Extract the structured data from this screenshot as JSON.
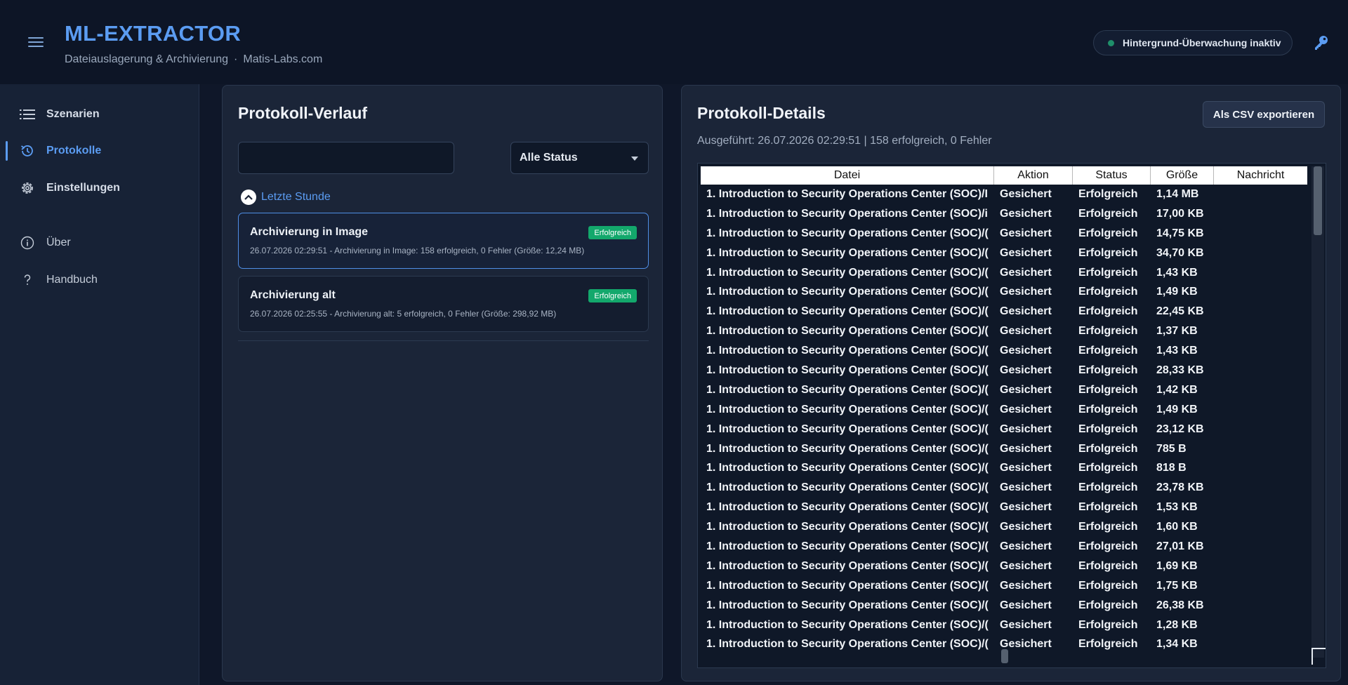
{
  "header": {
    "title": "ML-EXTRACTOR",
    "subtitle": "Dateiauslagerung & Archivierung",
    "subtitle_sep": "·",
    "site": "Matis-Labs.com",
    "monitor_status": "Hintergrund-Überwachung inaktiv",
    "monitor_dot_color": "#1f8f6a"
  },
  "sidebar": {
    "items": [
      {
        "label": "Szenarien",
        "icon": "list-icon"
      },
      {
        "label": "Protokolle",
        "icon": "history-icon"
      },
      {
        "label": "Einstellungen",
        "icon": "gear-icon"
      },
      {
        "label": "Über",
        "icon": "info-icon"
      },
      {
        "label": "Handbuch",
        "icon": "help-icon"
      }
    ],
    "active": "Protokolle"
  },
  "history": {
    "title": "Protokoll-Verlauf",
    "search_value": "",
    "status_filter": "Alle Status",
    "group_label": "Letzte Stunde",
    "entries": [
      {
        "name": "Archivierung in Image",
        "badge": "Erfolgreich",
        "meta": "26.07.2026 02:29:51 - Archivierung in Image: 158 erfolgreich, 0 Fehler (Größe: 12,24 MB)"
      },
      {
        "name": "Archivierung alt",
        "badge": "Erfolgreich",
        "meta": "26.07.2026 02:25:55 - Archivierung alt: 5 erfolgreich, 0 Fehler (Größe: 298,92 MB)"
      }
    ]
  },
  "details": {
    "title": "Protokoll-Details",
    "export_label": "Als CSV exportieren",
    "exec_info": "Ausgeführt: 26.07.2026 02:29:51 | 158 erfolgreich, 0 Fehler",
    "columns": [
      "Datei",
      "Aktion",
      "Status",
      "Größe",
      "Nachricht"
    ],
    "rows": [
      [
        "1. Introduction to Security Operations Center (SOC)/I",
        "Gesichert",
        "Erfolgreich",
        "1,14 MB",
        ""
      ],
      [
        "1. Introduction to Security Operations Center (SOC)/i",
        "Gesichert",
        "Erfolgreich",
        "17,00 KB",
        ""
      ],
      [
        "1. Introduction to Security Operations Center (SOC)/(",
        "Gesichert",
        "Erfolgreich",
        "14,75 KB",
        ""
      ],
      [
        "1. Introduction to Security Operations Center (SOC)/(",
        "Gesichert",
        "Erfolgreich",
        "34,70 KB",
        ""
      ],
      [
        "1. Introduction to Security Operations Center (SOC)/(",
        "Gesichert",
        "Erfolgreich",
        "1,43 KB",
        ""
      ],
      [
        "1. Introduction to Security Operations Center (SOC)/(",
        "Gesichert",
        "Erfolgreich",
        "1,49 KB",
        ""
      ],
      [
        "1. Introduction to Security Operations Center (SOC)/(",
        "Gesichert",
        "Erfolgreich",
        "22,45 KB",
        ""
      ],
      [
        "1. Introduction to Security Operations Center (SOC)/(",
        "Gesichert",
        "Erfolgreich",
        "1,37 KB",
        ""
      ],
      [
        "1. Introduction to Security Operations Center (SOC)/(",
        "Gesichert",
        "Erfolgreich",
        "1,43 KB",
        ""
      ],
      [
        "1. Introduction to Security Operations Center (SOC)/(",
        "Gesichert",
        "Erfolgreich",
        "28,33 KB",
        ""
      ],
      [
        "1. Introduction to Security Operations Center (SOC)/(",
        "Gesichert",
        "Erfolgreich",
        "1,42 KB",
        ""
      ],
      [
        "1. Introduction to Security Operations Center (SOC)/(",
        "Gesichert",
        "Erfolgreich",
        "1,49 KB",
        ""
      ],
      [
        "1. Introduction to Security Operations Center (SOC)/(",
        "Gesichert",
        "Erfolgreich",
        "23,12 KB",
        ""
      ],
      [
        "1. Introduction to Security Operations Center (SOC)/(",
        "Gesichert",
        "Erfolgreich",
        "785 B",
        ""
      ],
      [
        "1. Introduction to Security Operations Center (SOC)/(",
        "Gesichert",
        "Erfolgreich",
        "818 B",
        ""
      ],
      [
        "1. Introduction to Security Operations Center (SOC)/(",
        "Gesichert",
        "Erfolgreich",
        "23,78 KB",
        ""
      ],
      [
        "1. Introduction to Security Operations Center (SOC)/(",
        "Gesichert",
        "Erfolgreich",
        "1,53 KB",
        ""
      ],
      [
        "1. Introduction to Security Operations Center (SOC)/(",
        "Gesichert",
        "Erfolgreich",
        "1,60 KB",
        ""
      ],
      [
        "1. Introduction to Security Operations Center (SOC)/(",
        "Gesichert",
        "Erfolgreich",
        "27,01 KB",
        ""
      ],
      [
        "1. Introduction to Security Operations Center (SOC)/(",
        "Gesichert",
        "Erfolgreich",
        "1,69 KB",
        ""
      ],
      [
        "1. Introduction to Security Operations Center (SOC)/(",
        "Gesichert",
        "Erfolgreich",
        "1,75 KB",
        ""
      ],
      [
        "1. Introduction to Security Operations Center (SOC)/(",
        "Gesichert",
        "Erfolgreich",
        "26,38 KB",
        ""
      ],
      [
        "1. Introduction to Security Operations Center (SOC)/(",
        "Gesichert",
        "Erfolgreich",
        "1,28 KB",
        ""
      ],
      [
        "1. Introduction to Security Operations Center (SOC)/(",
        "Gesichert",
        "Erfolgreich",
        "1,34 KB",
        ""
      ]
    ]
  },
  "colors": {
    "accent": "#5b9cf2",
    "success": "#13a86c",
    "background": "#0f1729",
    "panel": "#1b2538"
  }
}
